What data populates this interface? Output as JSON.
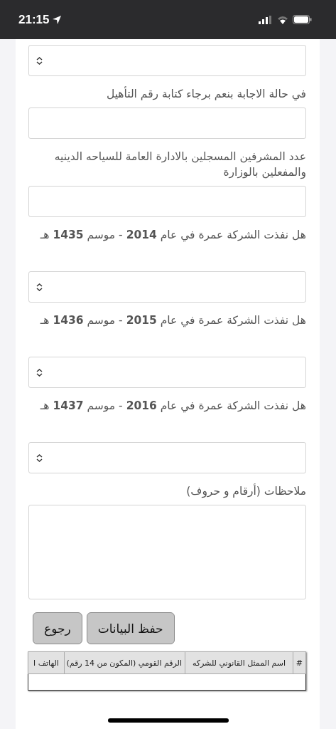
{
  "status_bar": {
    "time": "21:15"
  },
  "form": [
    {
      "kind": "select"
    },
    {
      "label": "في حالة الاجابة بنعم برجاء كتابة رقم التأهيل",
      "kind": "input"
    },
    {
      "label": "عدد المشرفين المسجلين بالادارة العامة للسياحه الدينيه والمفعلين بالوزارة",
      "kind": "input"
    },
    {
      "label": "هل نفذت الشركة عمرة في عام **2014** - موسم **1435** هـ",
      "kind": "select"
    },
    {
      "label": "هل نفذت الشركة عمرة في عام **2015** - موسم **1436** هـ",
      "kind": "select"
    },
    {
      "label": "هل نفذت الشركة عمرة في عام **2016** - موسم **1437** هـ",
      "kind": "select"
    },
    {
      "label": "ملاحظات (أرقام و حروف)",
      "kind": "textarea"
    }
  ],
  "buttons": [
    "حفظ البيانات",
    "رجوع"
  ],
  "table": {
    "columns": [
      "#",
      "اسم الممثل القانوني للشركه",
      "الرقم القومي (المكون من 14 رقم)",
      "الهاتف ا"
    ]
  }
}
